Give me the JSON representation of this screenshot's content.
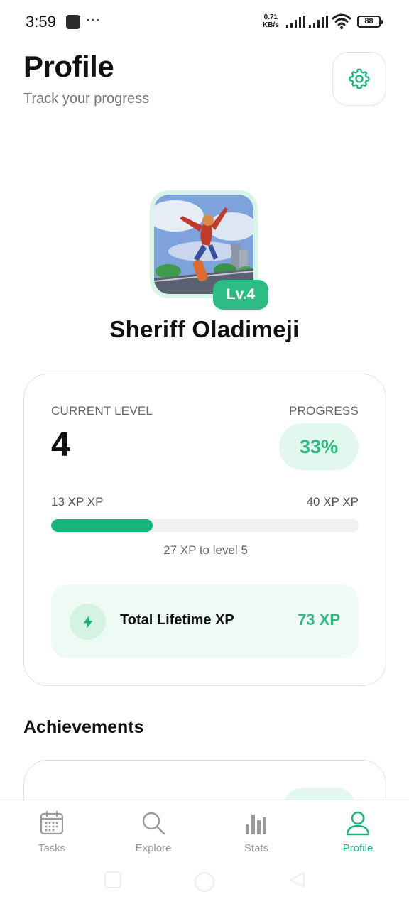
{
  "status_bar": {
    "time": "3:59",
    "more": "···",
    "speed_value": "0.71",
    "speed_unit": "KB/s",
    "battery": "88"
  },
  "header": {
    "title": "Profile",
    "subtitle": "Track your progress",
    "settings_icon": "gear-icon"
  },
  "profile": {
    "name": "Sheriff Oladimeji",
    "level_badge": "Lv.4"
  },
  "level_card": {
    "current_level_label": "CURRENT LEVEL",
    "current_level": "4",
    "progress_label": "PROGRESS",
    "progress_text": "33%",
    "progress_fraction": 0.33,
    "xp_current": "13 XP XP",
    "xp_target": "40 XP XP",
    "xp_remaining": "27 XP  to level 5",
    "lifetime_label": "Total Lifetime XP",
    "lifetime_value": "73 XP",
    "lifetime_icon": "lightning-icon"
  },
  "achievements": {
    "title": "Achievements"
  },
  "bottom_nav": {
    "items": [
      {
        "label": "Tasks",
        "icon": "calendar-icon",
        "active": false
      },
      {
        "label": "Explore",
        "icon": "search-icon",
        "active": false
      },
      {
        "label": "Stats",
        "icon": "bar-chart-icon",
        "active": false
      },
      {
        "label": "Profile",
        "icon": "user-icon",
        "active": true
      }
    ]
  },
  "colors": {
    "accent": "#2bbd83",
    "accent_dark": "#16b57a",
    "accent_light": "#e2f8ef"
  }
}
